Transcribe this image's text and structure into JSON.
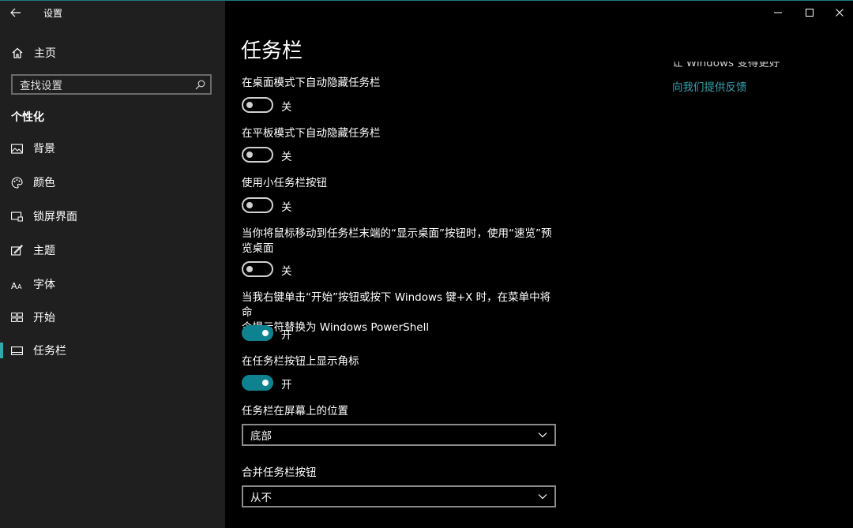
{
  "window": {
    "app_title": "设置",
    "controls": [
      "minimize-icon",
      "maximize-icon",
      "close-icon"
    ]
  },
  "sidebar": {
    "home_label": "主页",
    "search_placeholder": "查找设置",
    "section_title": "个性化",
    "items": [
      {
        "label": "背景",
        "icon": "picture-icon"
      },
      {
        "label": "颜色",
        "icon": "palette-icon"
      },
      {
        "label": "锁屏界面",
        "icon": "lock-screen-icon"
      },
      {
        "label": "主题",
        "icon": "theme-brush-icon"
      },
      {
        "label": "字体",
        "icon": "font-icon"
      },
      {
        "label": "开始",
        "icon": "start-grid-icon"
      },
      {
        "label": "任务栏",
        "icon": "taskbar-icon",
        "selected": true
      }
    ]
  },
  "main": {
    "title": "任务栏",
    "options": [
      {
        "label": "在桌面模式下自动隐藏任务栏",
        "state": "关",
        "on": false
      },
      {
        "label": "在平板模式下自动隐藏任务栏",
        "state": "关",
        "on": false
      },
      {
        "label": "使用小任务栏按钮",
        "state": "关",
        "on": false
      },
      {
        "label_line1": "当你将鼠标移动到任务栏末端的“显示桌面”按钮时，使用“速览”预",
        "label_line2": "览桌面",
        "state": "关",
        "on": false
      },
      {
        "label_line1": "当我右键单击“开始”按钮或按下 Windows 键+X 时，在菜单中将命",
        "label_line2": "令提示符替换为 Windows PowerShell",
        "state": "开",
        "on": true
      },
      {
        "label": "在任务栏按钮上显示角标",
        "state": "开",
        "on": true
      }
    ],
    "position": {
      "label": "任务栏在屏幕上的位置",
      "value": "底部"
    },
    "combine": {
      "label": "合并任务栏按钮",
      "value": "从不"
    }
  },
  "right": {
    "clipped_text": "让 Windows 变得更好",
    "feedback_link": "向我们提供反馈"
  },
  "colors": {
    "accent": "#0f8290",
    "link": "#3aa3b0",
    "sidebar_bg": "#1f1f1f",
    "main_bg": "#000000"
  }
}
